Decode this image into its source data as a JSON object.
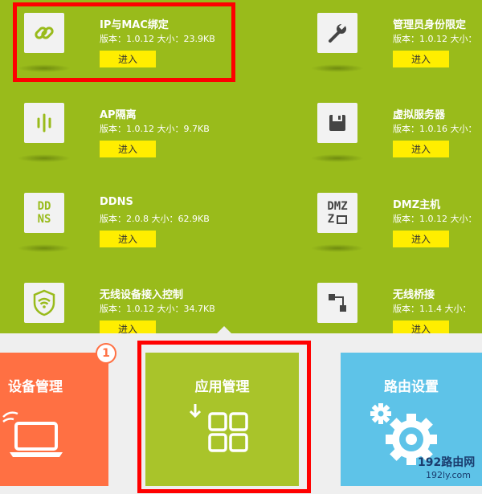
{
  "apps": [
    {
      "name": "IP与MAC绑定",
      "meta": "版本：1.0.12 大小：23.9KB",
      "button": "进入",
      "icon": "link-icon"
    },
    {
      "name": "管理员身份限定",
      "meta": "版本：1.0.12 大小：",
      "button": "进入",
      "icon": "wrench-icon"
    },
    {
      "name": "AP隔离",
      "meta": "版本：1.0.12 大小：9.7KB",
      "button": "进入",
      "icon": "ap-isolation-icon"
    },
    {
      "name": "虚拟服务器",
      "meta": "版本：1.0.16 大小：",
      "button": "进入",
      "icon": "floppy-icon"
    },
    {
      "name": "DDNS",
      "meta": "版本：2.0.8 大小：62.9KB",
      "button": "进入",
      "icon": "ddns-icon",
      "icon_text": [
        "DD",
        "NS"
      ]
    },
    {
      "name": "DMZ主机",
      "meta": "版本：1.0.12 大小：",
      "button": "进入",
      "icon": "dmz-icon",
      "icon_text": [
        "DMZ",
        "Z"
      ]
    },
    {
      "name": "无线设备接入控制",
      "meta": "版本：1.0.12 大小：34.7KB",
      "button": "进入",
      "icon": "wifi-shield-icon"
    },
    {
      "name": "无线桥接",
      "meta": "版本：1.1.4 大小：",
      "button": "进入",
      "icon": "bridge-icon"
    }
  ],
  "tabs": [
    {
      "label": "设备管理",
      "badge": "1",
      "color": "#ff7043",
      "icon": "laptop-icon"
    },
    {
      "label": "应用管理",
      "color": "#a9c42a",
      "icon": "apps-grid-icon"
    },
    {
      "label": "路由设置",
      "color": "#5ec3e8",
      "icon": "gear-icon"
    }
  ],
  "watermark": {
    "line1": "192路由网",
    "line2": "192ly.com"
  },
  "colors": {
    "app_bg": "#99bb1b",
    "button": "#ffee00",
    "highlight": "#ff0000",
    "bottom_bg": "#efefef"
  }
}
